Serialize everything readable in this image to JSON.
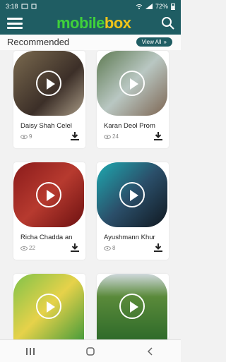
{
  "status": {
    "time": "3:18",
    "battery": "72%"
  },
  "appbar": {
    "logo_part1": "mobile",
    "logo_part2": "box"
  },
  "section": {
    "title": "Recommended",
    "view_all": "View All"
  },
  "videos": [
    {
      "title": "Daisy Shah Celel",
      "views": "9"
    },
    {
      "title": "Karan Deol Prom",
      "views": "24"
    },
    {
      "title": "Richa Chadda an",
      "views": "22"
    },
    {
      "title": "Ayushmann Khur",
      "views": "8"
    },
    {
      "title": "",
      "views": ""
    },
    {
      "title": "",
      "views": ""
    }
  ],
  "colors": {
    "header": "#1f5d63",
    "accent_green": "#3fd13a",
    "accent_yellow": "#f0c419"
  },
  "icons": [
    "menu-icon",
    "search-icon",
    "play-icon",
    "eye-icon",
    "download-icon",
    "recents-icon",
    "home-icon",
    "back-icon"
  ]
}
